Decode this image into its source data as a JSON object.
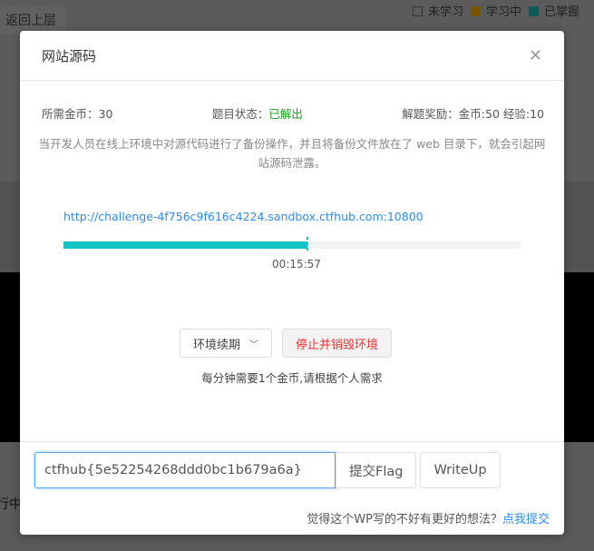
{
  "background": {
    "back_label": "返回上层",
    "legend": [
      {
        "label": "未学习",
        "color": "#5b5b5b"
      },
      {
        "label": "学习中",
        "color": "#7a5500"
      },
      {
        "label": "已掌握",
        "color": "#0a5c5c"
      }
    ],
    "side_fragment": "行中"
  },
  "modal": {
    "title": "网站源码",
    "info": {
      "cost_label": "所需金币：",
      "cost": "30",
      "status_label": "题目状态：",
      "status": "已解出",
      "reward_label": "解题奖励：",
      "reward": "金币:50 经验:10"
    },
    "description": "当开发人员在线上环境中对源代码进行了备份操作，并且将备份文件放在了 web 目录下，就会引起网站源码泄露。",
    "url": "http://challenge-4f756c9f616c4224.sandbox.ctfhub.com:10800",
    "progress_percent": 53.4,
    "time_remaining": "00:15:57",
    "renew_label": "环境续期",
    "destroy_label": "停止并销毁环境",
    "note": "每分钟需要1个金币,请根据个人需求",
    "flag_value": "ctfhub{5e52254268ddd0bc1b679a6a}",
    "submit_label": "提交Flag",
    "writeup_label": "WriteUp",
    "feedback_text": "觉得这个WP写的不好有更好的想法？",
    "feedback_link": "点我提交"
  }
}
